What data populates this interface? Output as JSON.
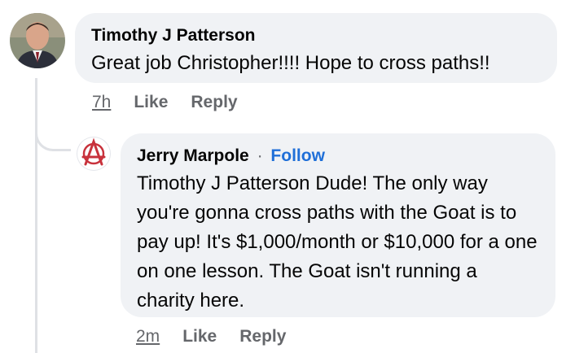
{
  "comment": {
    "author": "Timothy J Patterson",
    "text": "Great job Christopher!!!! Hope to cross paths!!",
    "time": "7h",
    "like_label": "Like",
    "reply_label": "Reply"
  },
  "reply": {
    "author": "Jerry Marpole",
    "separator": "·",
    "follow_label": "Follow",
    "text": "Timothy J Patterson Dude! The only way you're gonna cross paths with the Goat is to pay up! It's $1,000/month or $10,000 for a one on one lesson. The Goat isn't running a charity here.",
    "time": "2m",
    "like_label": "Like",
    "reply_label": "Reply"
  },
  "colors": {
    "bubble": "#f0f2f5",
    "link": "#1f6fd8",
    "meta": "#65676b",
    "anarchy_red": "#c8323c"
  }
}
